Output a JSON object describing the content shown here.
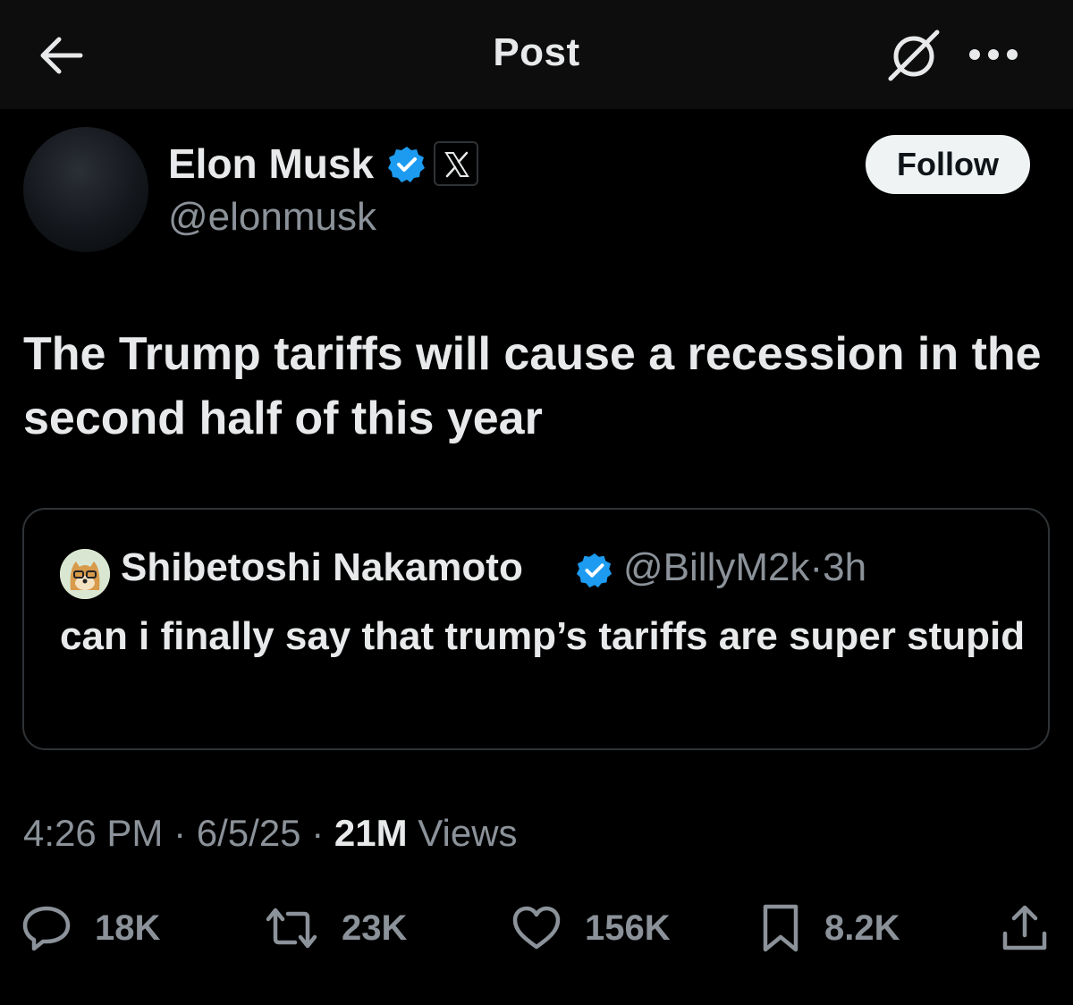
{
  "header": {
    "title": "Post",
    "back_icon": "arrow-left-icon",
    "grok_icon": "grok-icon",
    "more_icon": "more-horizontal-icon"
  },
  "author": {
    "display_name": "Elon Musk",
    "handle": "@elonmusk",
    "verified": true,
    "affiliation_badge": "X",
    "follow_label": "Follow"
  },
  "post": {
    "text": "The Trump tariffs will cause a recession in the second half of this year"
  },
  "quoted_post": {
    "display_name": "Shibetoshi Nakamoto",
    "handle": "@BillyM2k",
    "separator": "·",
    "time": "3h",
    "text": "can i finally say that trump’s tariffs are super stupid",
    "verified": true
  },
  "meta": {
    "time": "4:26 PM",
    "date": "6/5/25",
    "views_count": "21M",
    "views_label": "Views",
    "separator": "·"
  },
  "actions": {
    "replies": "18K",
    "reposts": "23K",
    "likes": "156K",
    "bookmarks": "8.2K"
  },
  "colors": {
    "background": "#000000",
    "verified_blue": "#1d9bf0",
    "muted_text": "#8b9299",
    "primary_text": "#e7e9ea"
  }
}
